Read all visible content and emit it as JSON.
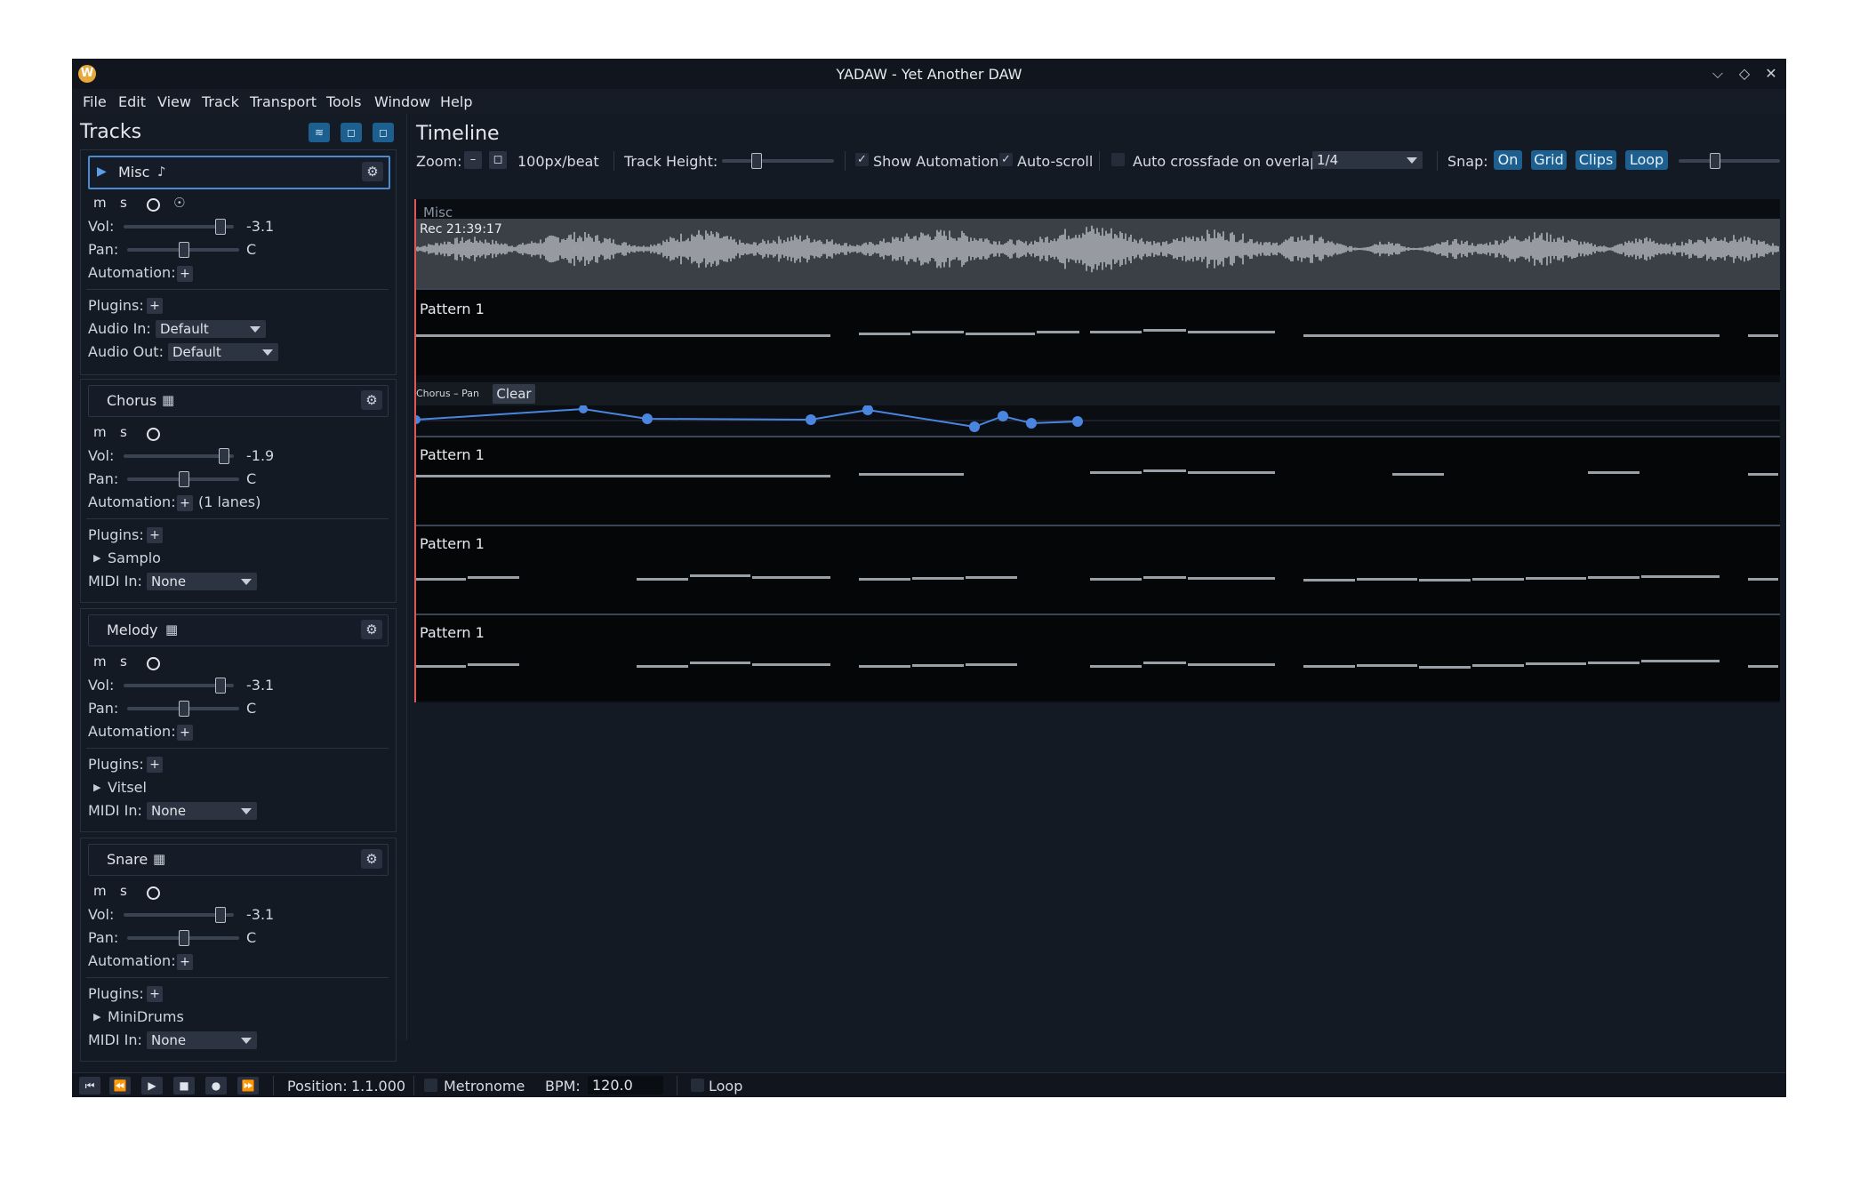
{
  "window": {
    "title": "YADAW - Yet Another DAW",
    "icon_letter": "W"
  },
  "menu": [
    "File",
    "Edit",
    "View",
    "Track",
    "Transport",
    "Tools",
    "Window",
    "Help"
  ],
  "tracks_panel": {
    "title": "Tracks",
    "labels": {
      "vol": "Vol:",
      "pan": "Pan:",
      "automation": "Automation:",
      "plugins": "Plugins:",
      "audio_in": "Audio In:",
      "audio_out": "Audio Out:",
      "midi_in": "MIDI In:",
      "mute": "m",
      "solo": "s",
      "plus": "+"
    },
    "tracks": [
      {
        "name": "Misc",
        "type": "audio",
        "selected": true,
        "vol": "-3.1",
        "vol_level": 0.87,
        "pan": "C",
        "pan_level": 0.5,
        "automation_note": "",
        "audio_in": "Default",
        "audio_out": "Default"
      },
      {
        "name": "Chorus",
        "type": "instrument",
        "selected": false,
        "vol": "-1.9",
        "vol_level": 0.9,
        "pan": "C",
        "pan_level": 0.5,
        "automation_note": "(1 lanes)",
        "plugin": "Samplo",
        "midi_in": "None"
      },
      {
        "name": "Melody",
        "type": "instrument",
        "selected": false,
        "vol": "-3.1",
        "vol_level": 0.87,
        "pan": "C",
        "pan_level": 0.5,
        "automation_note": "",
        "plugin": "Vitsel",
        "midi_in": "None"
      },
      {
        "name": "Snare",
        "type": "instrument",
        "selected": false,
        "vol": "-3.1",
        "vol_level": 0.87,
        "pan": "C",
        "pan_level": 0.5,
        "automation_note": "",
        "plugin": "MiniDrums",
        "midi_in": "None"
      }
    ]
  },
  "timeline": {
    "title": "Timeline",
    "zoom_label": "Zoom:",
    "zoom_minus": "–",
    "zoom_value": "100px/beat",
    "track_height_label": "Track Height:",
    "track_height_level": 0.3,
    "show_automation": {
      "label": "Show Automation",
      "checked": true
    },
    "auto_scroll": {
      "label": "Auto-scroll",
      "checked": true
    },
    "auto_crossfade": {
      "label": "Auto crossfade on overlap",
      "checked": false
    },
    "grid_value": "1/4",
    "snap_label": "Snap:",
    "snap_buttons": [
      "On",
      "Grid",
      "Clips",
      "Loop"
    ],
    "snap_slider_level": 0.35,
    "misc_label": "Misc",
    "audio_clip_label": "Rec 21:39:17",
    "pattern_label": "Pattern 1",
    "automation_lane_label": "Chorus – Pan",
    "clear_label": "Clear",
    "check_mark": "✓"
  },
  "transport": {
    "position_label": "Position:",
    "position_value": "1.1.000",
    "metronome_label": "Metronome",
    "bpm_label": "BPM:",
    "bpm_value": "120.0",
    "loop_label": "Loop"
  },
  "colors": {
    "accent": "#1d5f8f",
    "playhead": "#e05555",
    "automation": "#4a86e0",
    "waveform": "#c9ccd2"
  }
}
